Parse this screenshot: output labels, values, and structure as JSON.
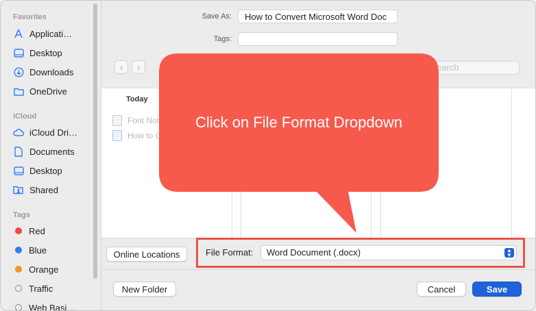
{
  "sidebar": {
    "favorites_heading": "Favorites",
    "favorites": [
      {
        "label": "Applicati…",
        "icon": "applications-icon"
      },
      {
        "label": "Desktop",
        "icon": "desktop-icon"
      },
      {
        "label": "Downloads",
        "icon": "downloads-icon"
      },
      {
        "label": "OneDrive",
        "icon": "folder-icon"
      }
    ],
    "icloud_heading": "iCloud",
    "icloud": [
      {
        "label": "iCloud Dri…",
        "icon": "cloud-icon"
      },
      {
        "label": "Documents",
        "icon": "document-icon"
      },
      {
        "label": "Desktop",
        "icon": "desktop-icon"
      },
      {
        "label": "Shared",
        "icon": "shared-folder-icon"
      }
    ],
    "tags_heading": "Tags",
    "tags": [
      {
        "label": "Red",
        "color": "#f04a44"
      },
      {
        "label": "Blue",
        "color": "#2f7cf6"
      },
      {
        "label": "Orange",
        "color": "#f5951e"
      },
      {
        "label": "Traffic",
        "color": "none"
      },
      {
        "label": "Web Basi…",
        "color": "none"
      }
    ]
  },
  "save_as": {
    "label": "Save As:",
    "value": "How to Convert Microsoft Word Doc"
  },
  "tags_field": {
    "label": "Tags:",
    "value": ""
  },
  "search": {
    "placeholder": "Search",
    "visible_text": "earch"
  },
  "browser": {
    "column_heading": "Today",
    "files": [
      "Font Not",
      "How to C"
    ]
  },
  "bottom": {
    "online_locations": "Online Locations",
    "file_format_label": "File Format:",
    "file_format_value": "Word Document (.docx)",
    "new_folder": "New Folder",
    "cancel": "Cancel",
    "save": "Save"
  },
  "callout": {
    "text": "Click on File Format Dropdown",
    "color": "#f65a4c"
  },
  "accent_color": "#1f63d8"
}
